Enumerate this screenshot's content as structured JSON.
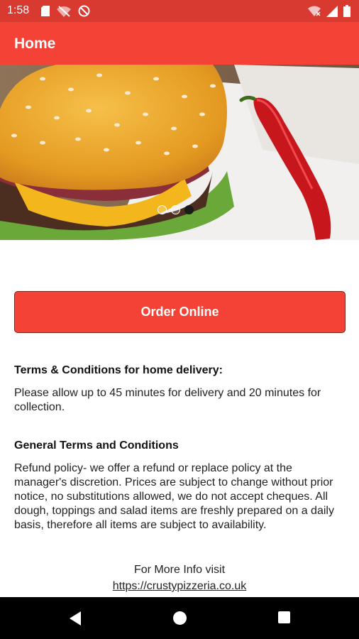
{
  "status_bar": {
    "time": "1:58",
    "left_icons": [
      "sd-card-icon",
      "wifi-off-icon",
      "blocked-icon"
    ],
    "right_icons": [
      "wifi-signal-icon",
      "cell-signal-icon",
      "battery-icon"
    ]
  },
  "app_bar": {
    "title": "Home"
  },
  "banner": {
    "image": "burger-and-chili-photo",
    "carousel_pages": 3,
    "active_page": 3
  },
  "order_button": {
    "label": "Order Online"
  },
  "terms_delivery": {
    "heading": "Terms & Conditions for home delivery:",
    "text": "Please allow up to 45 minutes for delivery and 20 minutes for collection."
  },
  "general_terms": {
    "heading": "General Terms and Conditions",
    "text": "Refund policy- we offer a refund or replace policy at the manager's discretion. Prices are subject to change without prior notice, no substitutions allowed, we do not accept cheques. All dough, toppings and salad items are freshly prepared on a daily basis, therefore all items are subject to availability."
  },
  "footer": {
    "more_info": "For More Info visit",
    "link": "https://crustypizzeria.co.uk"
  },
  "colors": {
    "status_bar": "#d83a2f",
    "app_bar": "#f44336",
    "button": "#f44336",
    "nav_bar": "#000000"
  },
  "nav_bar": {
    "buttons": [
      "back-icon",
      "home-icon",
      "recents-icon"
    ]
  }
}
